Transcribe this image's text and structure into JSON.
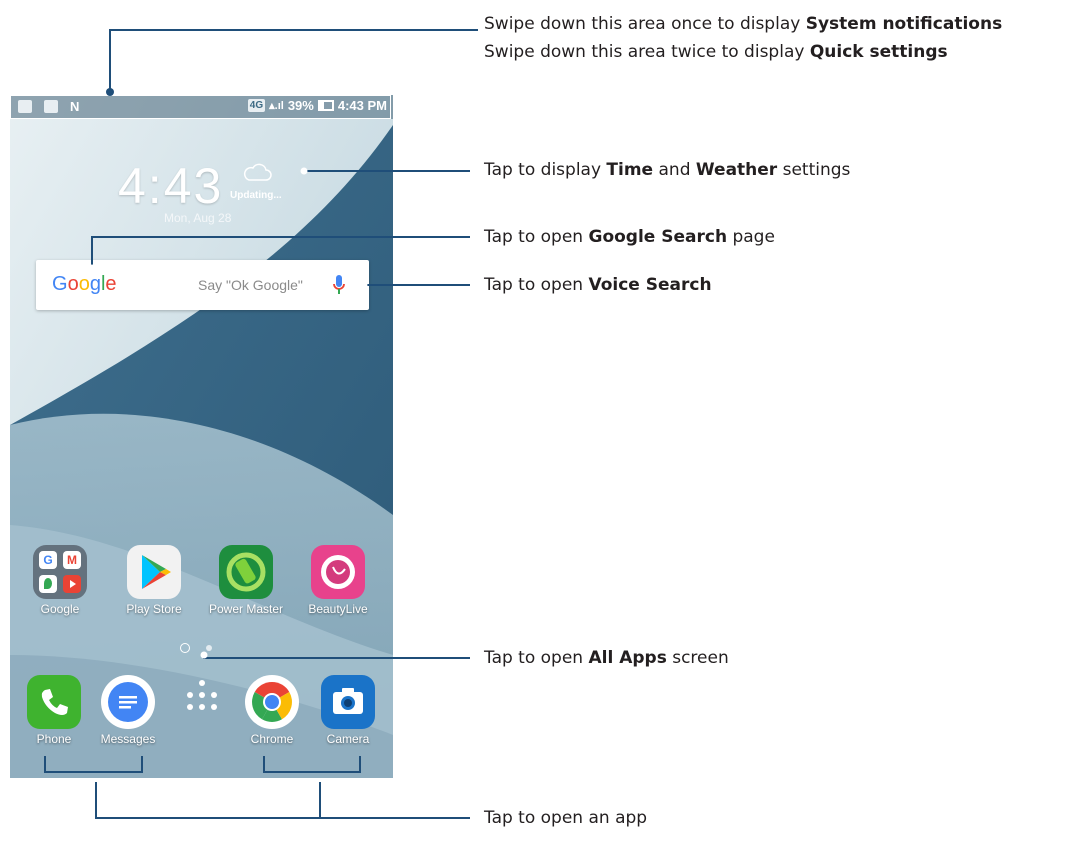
{
  "status_bar": {
    "network": "4G",
    "battery": "39%",
    "time": "4:43 PM"
  },
  "home": {
    "clock": "4:43",
    "date": "Mon, Aug 28",
    "weather": "Updating..."
  },
  "search": {
    "logo": "Google",
    "hint": "Say \"Ok Google\""
  },
  "apps": [
    {
      "label": "Google"
    },
    {
      "label": "Play Store"
    },
    {
      "label": "Power Master"
    },
    {
      "label": "BeautyLive"
    }
  ],
  "dock": [
    {
      "label": "Phone"
    },
    {
      "label": "Messages"
    },
    {
      "label": "Chrome"
    },
    {
      "label": "Camera"
    }
  ],
  "annotations": {
    "status_1_pre": "Swipe down this area once to display ",
    "status_1_bold": "System notifications",
    "status_2_pre": "Swipe down this area twice to display ",
    "status_2_bold": "Quick settings",
    "time_pre": "Tap to display ",
    "time_bold1": "Time",
    "time_mid": " and ",
    "time_bold2": "Weather",
    "time_post": " settings",
    "gsearch_pre": "Tap to open ",
    "gsearch_bold": "Google Search",
    "gsearch_post": " page",
    "voice_pre": "Tap to open ",
    "voice_bold": "Voice Search",
    "allapps_pre": "Tap to open ",
    "allapps_bold": "All Apps",
    "allapps_post": " screen",
    "openapp": "Tap to open an app"
  },
  "colors": {
    "annotation_line": "#1f4e79",
    "google_blue": "#4285f4",
    "google_red": "#ea4335",
    "google_yellow": "#fbbc05",
    "google_green": "#34a853"
  }
}
